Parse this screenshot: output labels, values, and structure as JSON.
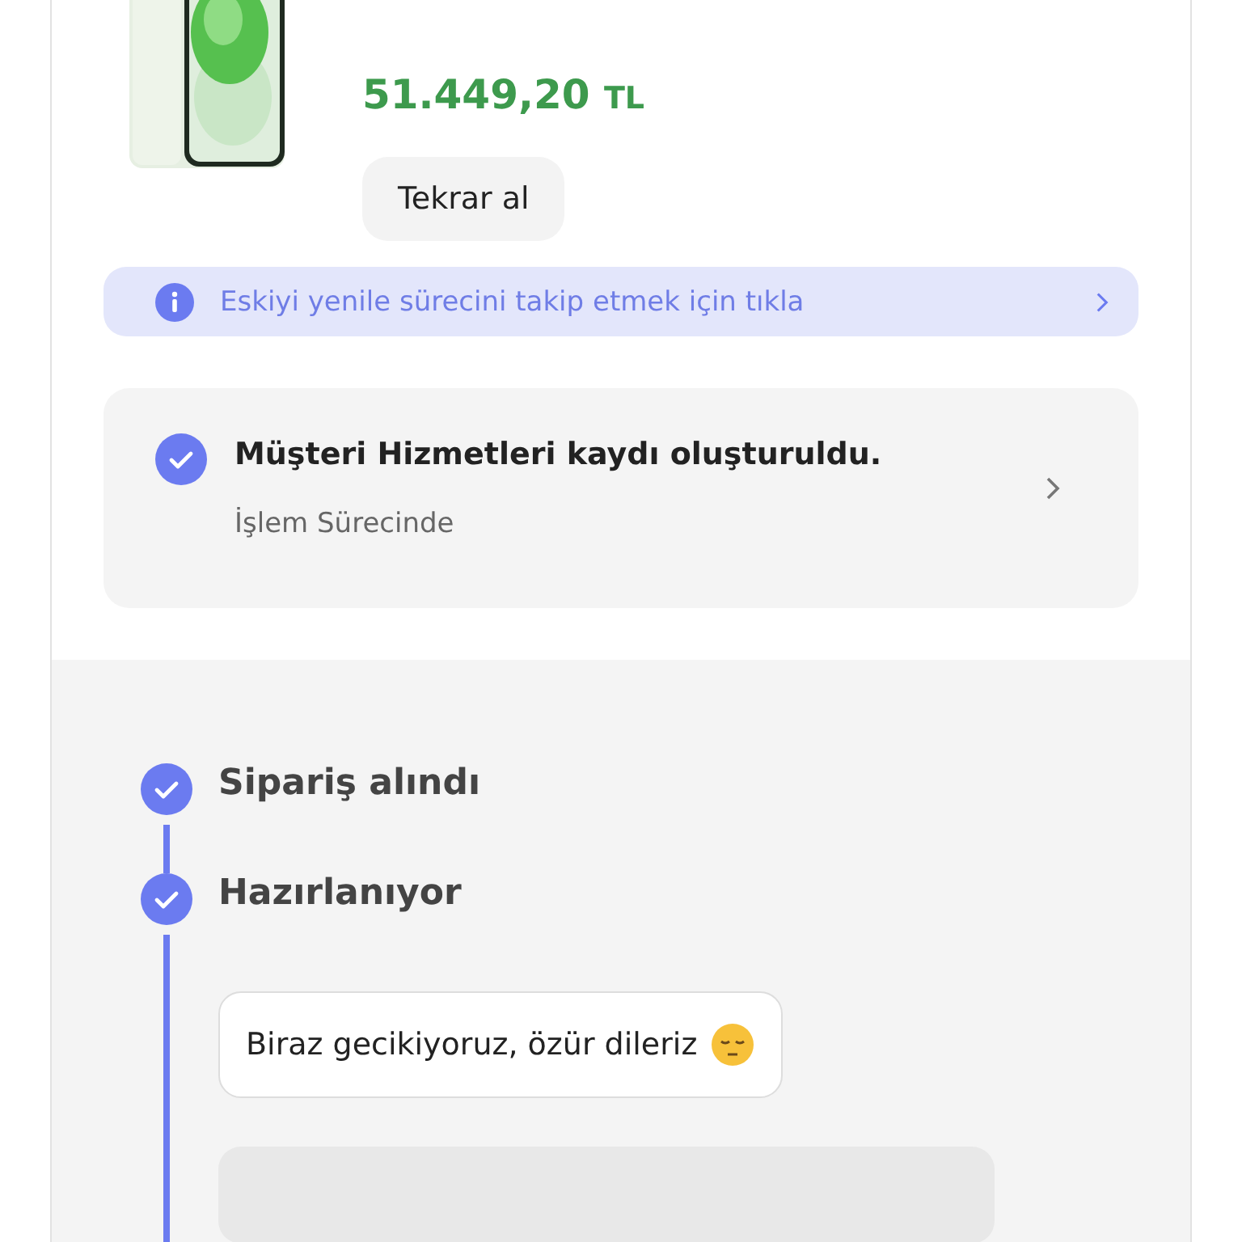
{
  "product": {
    "price": "51.449,20",
    "currency": "TL",
    "reorder_button": "Tekrar al"
  },
  "info_banner": {
    "text": "Eskiyi yenile sürecini takip etmek için tıkla"
  },
  "service_card": {
    "title": "Müşteri Hizmetleri kaydı oluşturuldu.",
    "status": "İşlem Sürecinde",
    "done": true
  },
  "timeline": [
    {
      "label": "Sipariş alındı",
      "done": true
    },
    {
      "label": "Hazırlanıyor",
      "done": true,
      "message": "Biraz gecikiyoruz, özür dileriz"
    }
  ]
}
